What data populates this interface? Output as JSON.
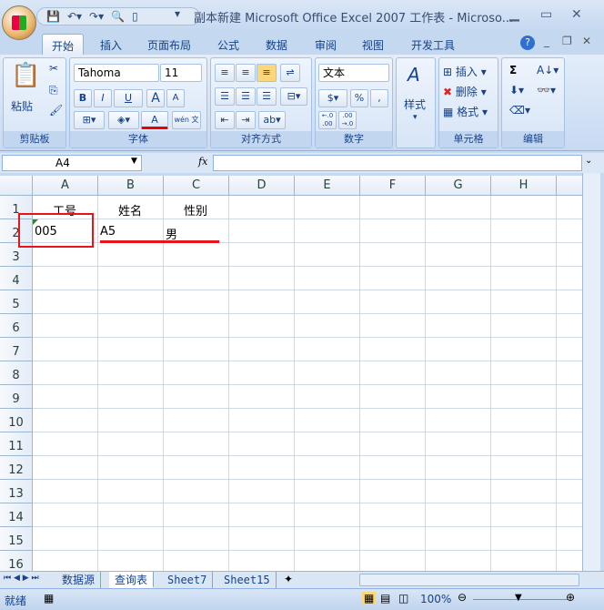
{
  "window": {
    "title": "副本新建 Microsoft Office Excel 2007 工作表 - Microso..."
  },
  "tabs": [
    "开始",
    "插入",
    "页面布局",
    "公式",
    "数据",
    "审阅",
    "视图",
    "开发工具"
  ],
  "ribbon": {
    "clipboard": {
      "paste": "粘贴",
      "label": "剪贴板"
    },
    "font": {
      "name": "Tahoma",
      "size": "11",
      "bold": "B",
      "italic": "I",
      "underline": "U",
      "grow": "A",
      "shrink": "A",
      "fontcolor": "A",
      "phonetic": "wén 文",
      "label": "字体"
    },
    "alignment": {
      "label": "对齐方式"
    },
    "number": {
      "format": "文本",
      "percent": "%",
      "comma": ",",
      "inc": "←.0 .00",
      "dec": ".00 →.0",
      "label": "数字"
    },
    "styles": {
      "label": "样式"
    },
    "cells": {
      "insert": "插入",
      "delete": "删除",
      "format": "格式",
      "label": "单元格"
    },
    "editing": {
      "sum": "Σ",
      "label": "编辑"
    }
  },
  "formula_bar": {
    "name_box": "A4",
    "fx": "fx",
    "value": ""
  },
  "columns": [
    "A",
    "B",
    "C",
    "D",
    "E",
    "F",
    "G",
    "H"
  ],
  "rows": [
    "1",
    "2",
    "3",
    "4",
    "5",
    "6",
    "7",
    "8",
    "9",
    "10",
    "11",
    "12",
    "13",
    "14",
    "15",
    "16"
  ],
  "cells": {
    "A1": "工号",
    "B1": "姓名",
    "C1": "性别",
    "A2": "005",
    "B2": "A5",
    "C2": "男"
  },
  "sheets": [
    "数据源",
    "查询表",
    "Sheet7",
    "Sheet15"
  ],
  "active_sheet": "查询表",
  "status": {
    "ready": "就绪",
    "zoom": "100%"
  },
  "colors": {
    "annotation": "#e8141c",
    "ribbon": "#dbe7f7"
  }
}
